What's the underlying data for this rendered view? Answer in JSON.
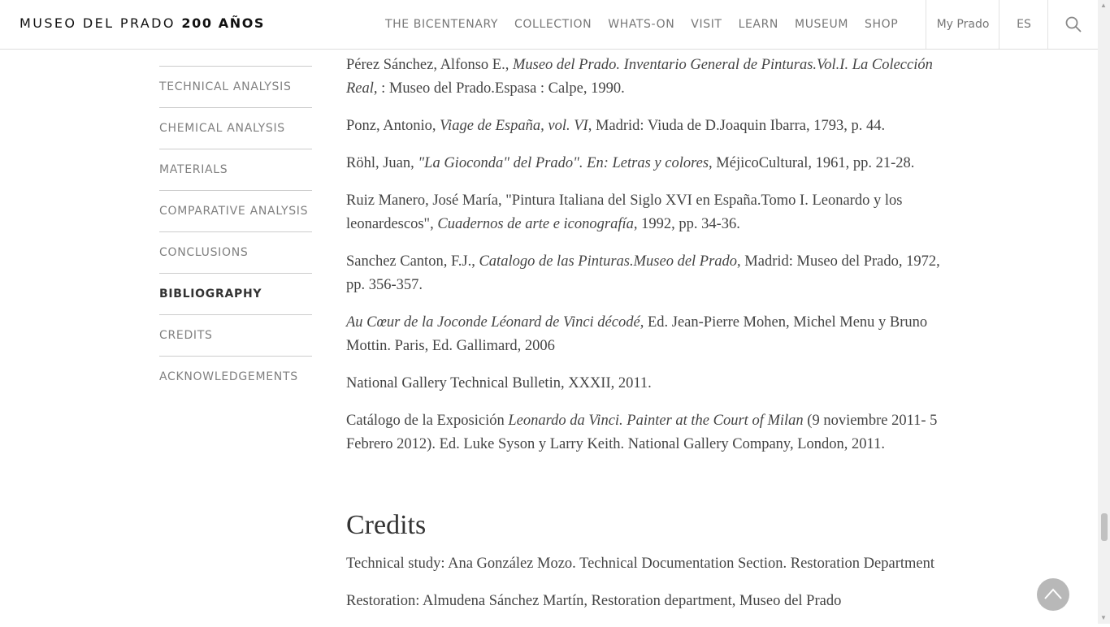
{
  "header": {
    "logo_text": "MUSEO DEL PRADO",
    "logo_bold": "200 AÑOS",
    "nav": [
      "THE BICENTENARY",
      "COLLECTION",
      "WHATS-ON",
      "VISIT",
      "LEARN",
      "MUSEUM",
      "SHOP"
    ],
    "my_prado": "My Prado",
    "lang": "ES",
    "search_icon": "search-icon"
  },
  "sidebar": {
    "items": [
      {
        "label": "TECHNICAL ANALYSIS"
      },
      {
        "label": "CHEMICAL ANALYSIS"
      },
      {
        "label": "MATERIALS"
      },
      {
        "label": "COMPARATIVE ANALYSIS"
      },
      {
        "label": "CONCLUSIONS"
      },
      {
        "label": "BIBLIOGRAPHY",
        "active": true
      },
      {
        "label": "CREDITS"
      },
      {
        "label": "ACKNOWLEDGEMENTS"
      }
    ]
  },
  "bibliography": [
    {
      "a": "Pérez Sánchez, Alfonso E., ",
      "i": "Museo del Prado. Inventario General de Pinturas.Vol.I. La Colección Real",
      "b": ", : Museo del Prado.Espasa : Calpe, 1990."
    },
    {
      "a": "Ponz, Antonio, ",
      "i": "Viage de España, vol. VI",
      "b": ", Madrid: Viuda de D.Joaquin Ibarra, 1793, p. 44."
    },
    {
      "a": "Röhl, Juan, ",
      "i": "\"La Gioconda\" del Prado\". En: Letras y colores",
      "b": ", MéjicoCultural, 1961, pp. 21-28."
    },
    {
      "a": "Ruiz Manero, José María, \"Pintura Italiana del Siglo XVI en España.Tomo I. Leonardo y los leonardescos\", ",
      "i": "Cuadernos de arte e iconografía",
      "b": ", 1992, pp. 34-36."
    },
    {
      "a": "Sanchez Canton, F.J., ",
      "i": "Catalogo de las Pinturas.Museo del Prado",
      "b": ", Madrid: Museo del Prado, 1972, pp. 356-357."
    },
    {
      "a": "",
      "i": "Au Cœur de la Joconde Léonard de Vinci décodé",
      "b": ", Ed. Jean-Pierre Mohen, Michel Menu y Bruno Mottin. Paris, Ed. Gallimard, 2006"
    },
    {
      "a": "National Gallery Technical Bulletin, XXXII, 2011.",
      "i": "",
      "b": ""
    },
    {
      "a": "Catálogo de la Exposición ",
      "i": "Leonardo da Vinci. Painter at the Court of Milan",
      "b": " (9 noviembre 2011- 5 Febrero 2012). Ed. Luke Syson y Larry Keith. National Gallery Company, London, 2011."
    }
  ],
  "credits": {
    "title": "Credits",
    "lines": [
      "Technical study: Ana González Mozo. Technical Documentation Section. Restoration Department",
      "Restoration: Almudena Sánchez Martín, Restoration department, Museo del Prado"
    ]
  },
  "back_to_top_icon": "chevron-up-icon",
  "colors": {
    "text": "#444444",
    "nav": "#777777",
    "active": "#333333",
    "divider": "#cccccc"
  }
}
